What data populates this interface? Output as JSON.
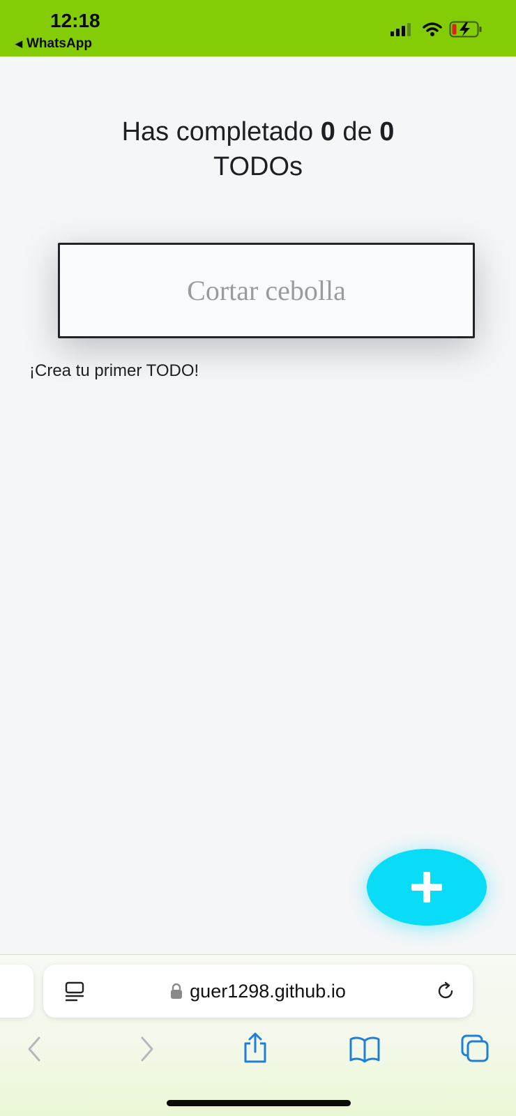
{
  "status_bar": {
    "time": "12:18",
    "back_app": "WhatsApp",
    "background_color": "#84cc05"
  },
  "main": {
    "heading_prefix": "Has completado ",
    "completed_count": "0",
    "heading_mid": " de ",
    "total_count": "0",
    "heading_suffix": "TODOs",
    "input_placeholder": "Cortar cebolla",
    "empty_message": "¡Crea tu primer TODO!",
    "add_button_icon": "plus-icon",
    "accent_color": "#08dcf6"
  },
  "browser": {
    "url": "guer1298.github.io",
    "toolbar_icons": [
      "back-icon",
      "forward-icon",
      "share-icon",
      "bookmarks-icon",
      "tabs-icon"
    ]
  }
}
